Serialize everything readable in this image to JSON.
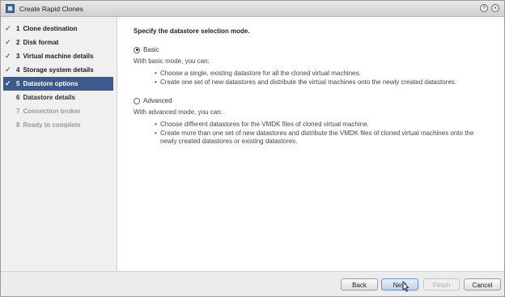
{
  "window": {
    "title": "Create Rapid Clones",
    "help_icon": "help-icon",
    "close_icon": "close-icon"
  },
  "sidebar": {
    "steps": [
      {
        "num": "1",
        "label": "Clone destination",
        "state": "done"
      },
      {
        "num": "2",
        "label": "Disk format",
        "state": "done"
      },
      {
        "num": "3",
        "label": "Virtual machine details",
        "state": "done"
      },
      {
        "num": "4",
        "label": "Storage system details",
        "state": "done"
      },
      {
        "num": "5",
        "label": "Datastore options",
        "state": "active"
      },
      {
        "num": "6",
        "label": "Datastore details",
        "state": "enabled"
      },
      {
        "num": "7",
        "label": "Connection broker",
        "state": "disabled"
      },
      {
        "num": "8",
        "label": "Ready to complete",
        "state": "disabled"
      }
    ]
  },
  "main": {
    "heading": "Specify the datastore selection mode.",
    "basic": {
      "label": "Basic",
      "selected": true,
      "desc": "With basic mode, you can:",
      "bullets": [
        "Choose a single, existing datastore for all the cloned virtual machines.",
        "Create one set of new datastores and distribute the virtual machines onto the newly created datastores."
      ]
    },
    "advanced": {
      "label": "Advanced",
      "selected": false,
      "desc": "With advanced mode, you can:",
      "bullets": [
        "Choose different datastores for the VMDK files of cloned virtual machine.",
        "Create more than one set of new datastores and distribute the VMDK files of cloned virtual machines onto the newly created datastores or existing datastores."
      ]
    }
  },
  "footer": {
    "back": "Back",
    "next": "Next",
    "finish": "Finish",
    "cancel": "Cancel"
  },
  "colors": {
    "active_step": "#3d5a8c",
    "check": "#3a9a2e"
  }
}
